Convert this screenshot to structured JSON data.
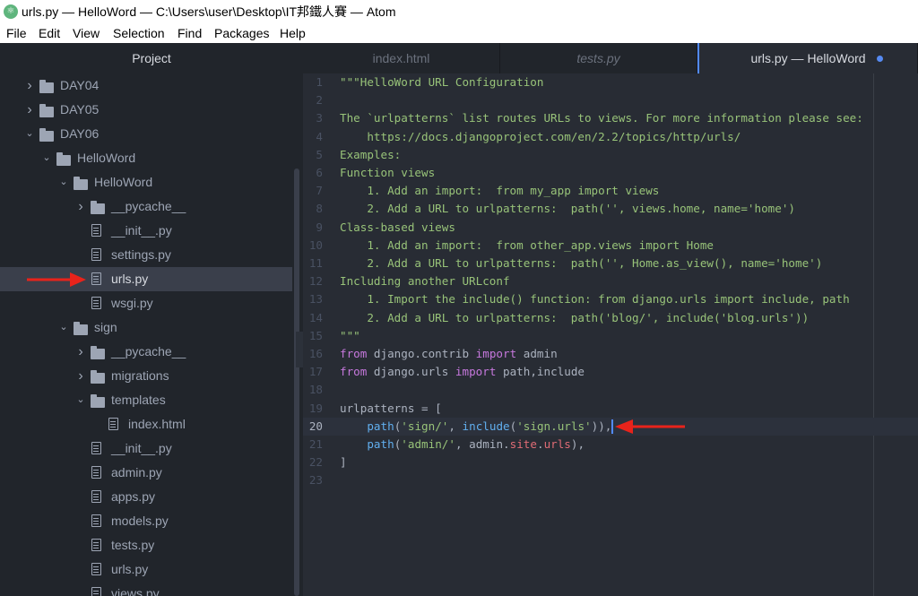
{
  "window": {
    "title": "urls.py — HelloWord — C:\\Users\\user\\Desktop\\IT邦鐵人賽 — Atom",
    "app_icon": "atom-icon"
  },
  "menu": {
    "items": [
      "File",
      "Edit",
      "View",
      "Selection",
      "Find",
      "Packages",
      "Help"
    ]
  },
  "sidebar": {
    "title": "Project",
    "tree": [
      {
        "label": "DAY04",
        "type": "folder",
        "expanded": false
      },
      {
        "label": "DAY05",
        "type": "folder",
        "expanded": false
      },
      {
        "label": "DAY06",
        "type": "folder",
        "expanded": true
      },
      {
        "label": "HelloWord",
        "type": "folder",
        "expanded": true
      },
      {
        "label": "HelloWord",
        "type": "folder",
        "expanded": true
      },
      {
        "label": "__pycache__",
        "type": "folder",
        "expanded": false
      },
      {
        "label": "__init__.py",
        "type": "file"
      },
      {
        "label": "settings.py",
        "type": "file"
      },
      {
        "label": "urls.py",
        "type": "file",
        "selected": true
      },
      {
        "label": "wsgi.py",
        "type": "file"
      },
      {
        "label": "sign",
        "type": "folder",
        "expanded": true
      },
      {
        "label": "__pycache__",
        "type": "folder",
        "expanded": false
      },
      {
        "label": "migrations",
        "type": "folder",
        "expanded": false
      },
      {
        "label": "templates",
        "type": "folder",
        "expanded": true
      },
      {
        "label": "index.html",
        "type": "file"
      },
      {
        "label": "__init__.py",
        "type": "file"
      },
      {
        "label": "admin.py",
        "type": "file"
      },
      {
        "label": "apps.py",
        "type": "file"
      },
      {
        "label": "models.py",
        "type": "file"
      },
      {
        "label": "tests.py",
        "type": "file"
      },
      {
        "label": "urls.py",
        "type": "file"
      },
      {
        "label": "views.py",
        "type": "file"
      }
    ]
  },
  "tabs": [
    {
      "label": "index.html",
      "active": false
    },
    {
      "label": "tests.py",
      "active": false,
      "italic": true
    },
    {
      "label": "urls.py — HelloWord",
      "active": true,
      "modified": true
    }
  ],
  "editor": {
    "cursor_line": 20,
    "lines": [
      [
        {
          "t": "\"\"\"HelloWord URL Configuration",
          "c": "doc"
        }
      ],
      [],
      [
        {
          "t": "The `urlpatterns` list routes URLs to views. For more information please see:",
          "c": "doc"
        }
      ],
      [
        {
          "t": "    https://docs.djangoproject.com/en/2.2/topics/http/urls/",
          "c": "doc"
        }
      ],
      [
        {
          "t": "Examples:",
          "c": "doc"
        }
      ],
      [
        {
          "t": "Function views",
          "c": "doc"
        }
      ],
      [
        {
          "t": "    1. Add an import:  from my_app import views",
          "c": "doc"
        }
      ],
      [
        {
          "t": "    2. Add a URL to urlpatterns:  path('', views.home, name='home')",
          "c": "doc"
        }
      ],
      [
        {
          "t": "Class-based views",
          "c": "doc"
        }
      ],
      [
        {
          "t": "    1. Add an import:  from other_app.views import Home",
          "c": "doc"
        }
      ],
      [
        {
          "t": "    2. Add a URL to urlpatterns:  path('', Home.as_view(), name='home')",
          "c": "doc"
        }
      ],
      [
        {
          "t": "Including another URLconf",
          "c": "doc"
        }
      ],
      [
        {
          "t": "    1. Import the include() function: from django.urls import include, path",
          "c": "doc"
        }
      ],
      [
        {
          "t": "    2. Add a URL to urlpatterns:  path('blog/', include('blog.urls'))",
          "c": "doc"
        }
      ],
      [
        {
          "t": "\"\"\"",
          "c": "doc"
        }
      ],
      [
        {
          "t": "from",
          "c": "kw"
        },
        {
          "t": " django.contrib ",
          "c": "plain"
        },
        {
          "t": "import",
          "c": "kw"
        },
        {
          "t": " admin",
          "c": "plain"
        }
      ],
      [
        {
          "t": "from",
          "c": "kw"
        },
        {
          "t": " django.urls ",
          "c": "plain"
        },
        {
          "t": "import",
          "c": "kw"
        },
        {
          "t": " path,include",
          "c": "plain"
        }
      ],
      [],
      [
        {
          "t": "urlpatterns = [",
          "c": "plain"
        }
      ],
      [
        {
          "t": "    ",
          "c": "plain"
        },
        {
          "t": "path",
          "c": "fn"
        },
        {
          "t": "(",
          "c": "plain"
        },
        {
          "t": "'sign/'",
          "c": "str"
        },
        {
          "t": ", ",
          "c": "plain"
        },
        {
          "t": "include",
          "c": "fn"
        },
        {
          "t": "(",
          "c": "plain"
        },
        {
          "t": "'sign.urls'",
          "c": "str"
        },
        {
          "t": ")),",
          "c": "plain"
        }
      ],
      [
        {
          "t": "    ",
          "c": "plain"
        },
        {
          "t": "path",
          "c": "fn"
        },
        {
          "t": "(",
          "c": "plain"
        },
        {
          "t": "'admin/'",
          "c": "str"
        },
        {
          "t": ", admin.",
          "c": "plain"
        },
        {
          "t": "site",
          "c": "attr"
        },
        {
          "t": ".",
          "c": "plain"
        },
        {
          "t": "urls",
          "c": "attr"
        },
        {
          "t": "),",
          "c": "plain"
        }
      ],
      [
        {
          "t": "]",
          "c": "plain"
        }
      ],
      []
    ]
  },
  "colors": {
    "annotation_arrow": "#e8231b",
    "accent": "#528bff"
  }
}
